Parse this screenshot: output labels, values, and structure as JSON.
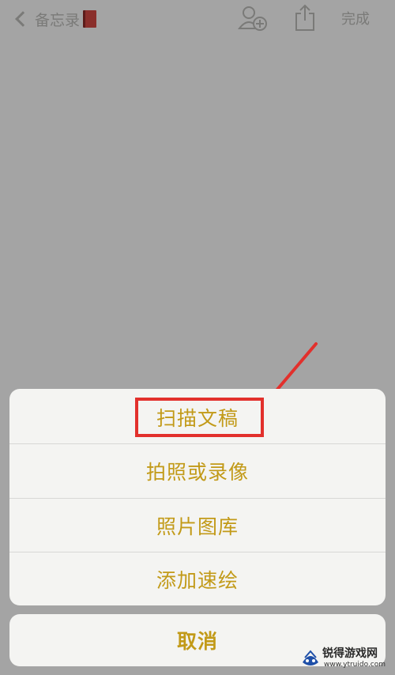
{
  "navbar": {
    "back_label": "备忘录",
    "done_label": "完成"
  },
  "action_sheet": {
    "items": [
      {
        "label": "扫描文稿",
        "highlighted": true
      },
      {
        "label": "拍照或录像"
      },
      {
        "label": "照片图库"
      },
      {
        "label": "添加速绘"
      }
    ],
    "cancel_label": "取消",
    "text_color": "#c29a18",
    "highlight_color": "#e2302c"
  },
  "watermark": {
    "title": "锐得游戏网",
    "url": "www.ytruido.com"
  }
}
